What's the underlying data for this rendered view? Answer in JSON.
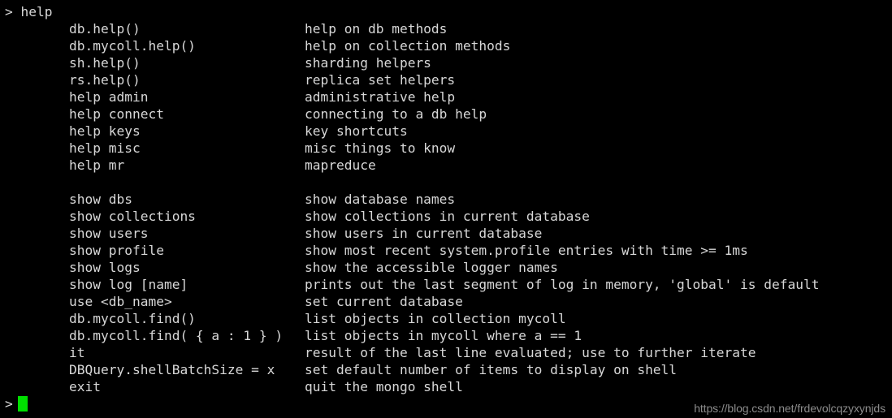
{
  "terminal": {
    "colors": {
      "background": "#000000",
      "foreground": "#d7d7d7",
      "cursor": "#00e000",
      "watermark": "#8c8c8c"
    },
    "prompt_symbol": ">",
    "input_line": {
      "prompt": ">",
      "command": "help"
    },
    "output_groups": [
      {
        "rows": [
          {
            "command": "db.help()",
            "description": "help on db methods"
          },
          {
            "command": "db.mycoll.help()",
            "description": "help on collection methods"
          },
          {
            "command": "sh.help()",
            "description": "sharding helpers"
          },
          {
            "command": "rs.help()",
            "description": "replica set helpers"
          },
          {
            "command": "help admin",
            "description": "administrative help"
          },
          {
            "command": "help connect",
            "description": "connecting to a db help"
          },
          {
            "command": "help keys",
            "description": "key shortcuts"
          },
          {
            "command": "help misc",
            "description": "misc things to know"
          },
          {
            "command": "help mr",
            "description": "mapreduce"
          }
        ]
      },
      {
        "rows": [
          {
            "command": "show dbs",
            "description": "show database names"
          },
          {
            "command": "show collections",
            "description": "show collections in current database"
          },
          {
            "command": "show users",
            "description": "show users in current database"
          },
          {
            "command": "show profile",
            "description": "show most recent system.profile entries with time >= 1ms"
          },
          {
            "command": "show logs",
            "description": "show the accessible logger names"
          },
          {
            "command": "show log [name]",
            "description": "prints out the last segment of log in memory, 'global' is default"
          },
          {
            "command": "use <db_name>",
            "description": "set current database"
          },
          {
            "command": "db.mycoll.find()",
            "description": "list objects in collection mycoll"
          },
          {
            "command": "db.mycoll.find( { a : 1 } )",
            "description": "list objects in mycoll where a == 1"
          },
          {
            "command": "it",
            "description": "result of the last line evaluated; use to further iterate"
          },
          {
            "command": "DBQuery.shellBatchSize = x",
            "description": "set default number of items to display on shell"
          },
          {
            "command": "exit",
            "description": "quit the mongo shell"
          }
        ]
      }
    ],
    "final_prompt": ">"
  },
  "watermark": {
    "text": "https://blog.csdn.net/frdevolcqzyxynjds"
  }
}
